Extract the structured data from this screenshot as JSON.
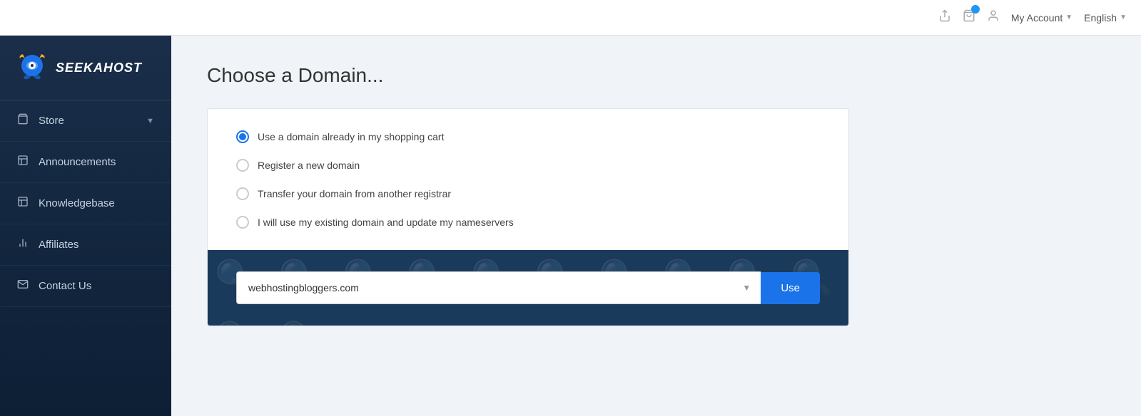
{
  "header": {
    "my_account_label": "My Account",
    "english_label": "English"
  },
  "sidebar": {
    "logo_text": "SEEKAHOST",
    "nav_items": [
      {
        "id": "store",
        "label": "Store",
        "icon": "🛍",
        "has_chevron": true
      },
      {
        "id": "announcements",
        "label": "Announcements",
        "icon": "📄"
      },
      {
        "id": "knowledgebase",
        "label": "Knowledgebase",
        "icon": "📋"
      },
      {
        "id": "affiliates",
        "label": "Affiliates",
        "icon": "📊"
      },
      {
        "id": "contact-us",
        "label": "Contact Us",
        "icon": "✉"
      }
    ]
  },
  "main": {
    "page_title": "Choose a Domain...",
    "radio_options": [
      {
        "id": "cart",
        "label": "Use a domain already in my shopping cart",
        "selected": true
      },
      {
        "id": "new",
        "label": "Register a new domain",
        "selected": false
      },
      {
        "id": "transfer",
        "label": "Transfer your domain from another registrar",
        "selected": false
      },
      {
        "id": "existing",
        "label": "I will use my existing domain and update my nameservers",
        "selected": false
      }
    ],
    "domain_select_value": "webhostingbloggers.com",
    "use_button_label": "Use"
  }
}
